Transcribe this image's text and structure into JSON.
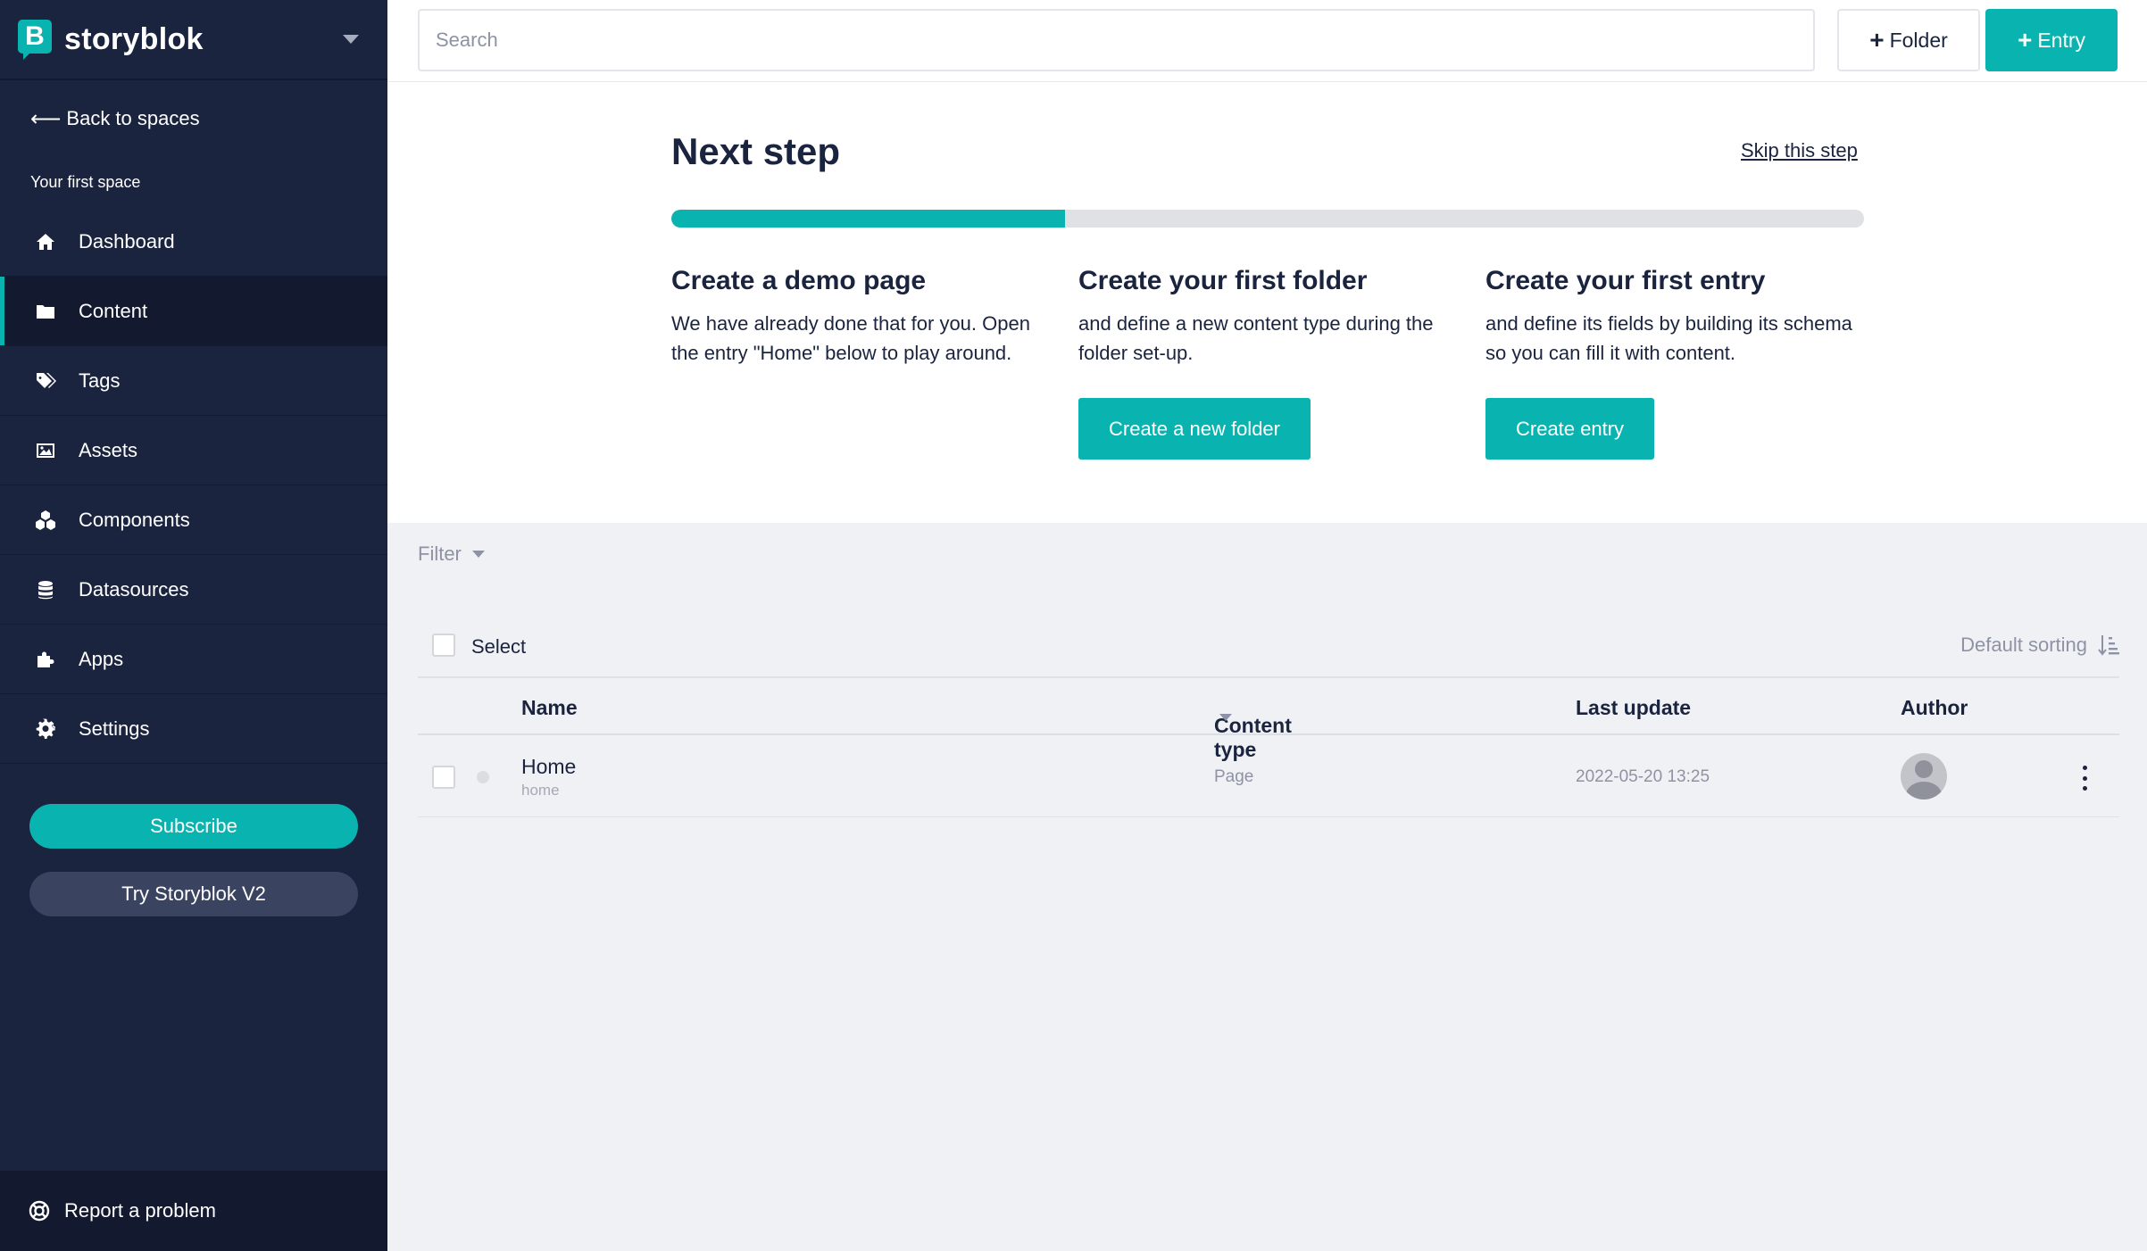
{
  "sidebar": {
    "brand": "storyblok",
    "back_label": "Back to spaces",
    "space_name": "Your first space",
    "items": [
      {
        "label": "Dashboard",
        "icon": "home-icon"
      },
      {
        "label": "Content",
        "icon": "folder-icon",
        "active": true
      },
      {
        "label": "Tags",
        "icon": "tags-icon"
      },
      {
        "label": "Assets",
        "icon": "image-icon"
      },
      {
        "label": "Components",
        "icon": "cubes-icon"
      },
      {
        "label": "Datasources",
        "icon": "database-icon"
      },
      {
        "label": "Apps",
        "icon": "puzzle-icon"
      },
      {
        "label": "Settings",
        "icon": "gear-icon"
      }
    ],
    "subscribe_label": "Subscribe",
    "try_v2_label": "Try Storyblok V2",
    "report_label": "Report a problem"
  },
  "topbar": {
    "search_placeholder": "Search",
    "folder_label": "Folder",
    "entry_label": "Entry"
  },
  "onboarding": {
    "title": "Next step",
    "skip_label": "Skip this step",
    "progress": 0.33,
    "steps": [
      {
        "title": "Create a demo page",
        "text": "We have already done that for you. Open the entry \"Home\" below to play around."
      },
      {
        "title": "Create your first folder",
        "text": "and define a new content type during the folder set-up.",
        "button": "Create a new folder"
      },
      {
        "title": "Create your first entry",
        "text": "and define its fields by building its schema so you can fill it with content.",
        "button": "Create entry"
      }
    ]
  },
  "list": {
    "filter_label": "Filter",
    "select_label": "Select",
    "sorting_label": "Default sorting",
    "columns": {
      "name": "Name",
      "content_type": "Content type",
      "last_update": "Last update",
      "author": "Author"
    },
    "rows": [
      {
        "name": "Home",
        "slug": "home",
        "content_type": "Page",
        "last_update": "2022-05-20 13:25"
      }
    ]
  },
  "colors": {
    "sidebar_bg": "#1b243f",
    "accent": "#09b3af",
    "page_bg": "#f0f1f4"
  }
}
